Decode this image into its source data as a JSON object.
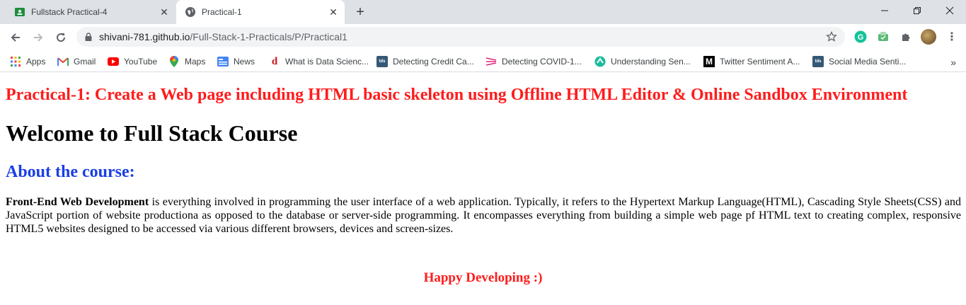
{
  "tabs": [
    {
      "title": "Fullstack Practical-4",
      "icon": "google-classroom-icon",
      "active": false
    },
    {
      "title": "Practical-1",
      "icon": "globe-icon",
      "active": true
    }
  ],
  "address_bar": {
    "host": "shivani-781.github.io",
    "path": "/Full-Stack-1-Practicals/P/Practical1"
  },
  "bookmarks": [
    {
      "label": "Apps",
      "icon": "apps-grid-icon"
    },
    {
      "label": "Gmail",
      "icon": "gmail-icon"
    },
    {
      "label": "YouTube",
      "icon": "youtube-icon"
    },
    {
      "label": "Maps",
      "icon": "maps-pin-icon"
    },
    {
      "label": "News",
      "icon": "news-icon"
    },
    {
      "label": "What is Data Scienc...",
      "icon": "d-icon"
    },
    {
      "label": "Detecting Credit Ca...",
      "icon": "tds-icon"
    },
    {
      "label": "Detecting COVID-1...",
      "icon": "stripes-icon"
    },
    {
      "label": "Understanding Sen...",
      "icon": "teal-icon"
    },
    {
      "label": "Twitter Sentiment A...",
      "icon": "medium-icon"
    },
    {
      "label": "Social Media Senti...",
      "icon": "tds-icon"
    }
  ],
  "content": {
    "title": "Practical-1: Create a Web page including HTML basic skeleton using Offline HTML Editor & Online Sandbox Environment",
    "heading": "Welcome to Full Stack Course",
    "subheading": "About the course:",
    "paragraph_bold": "Front-End Web Development",
    "paragraph_text": " is everything involved in programming the user interface of a web application. Typically, it refers to the Hypertext Markup Language(HTML), Cascading Style Sheets(CSS) and JavaScript portion of website productiona as opposed to the database or server-side programming. It encompasses everything from building a simple web page pf HTML text to creating complex, responsive HTML5 websites designed to be accessed via various different browsers, devices and screen-sizes.",
    "footer": "Happy Developing :)"
  },
  "colors": {
    "title": "#ff1c1c",
    "subheading": "#1a3ee6",
    "tabstrip": "#dee1e6"
  }
}
